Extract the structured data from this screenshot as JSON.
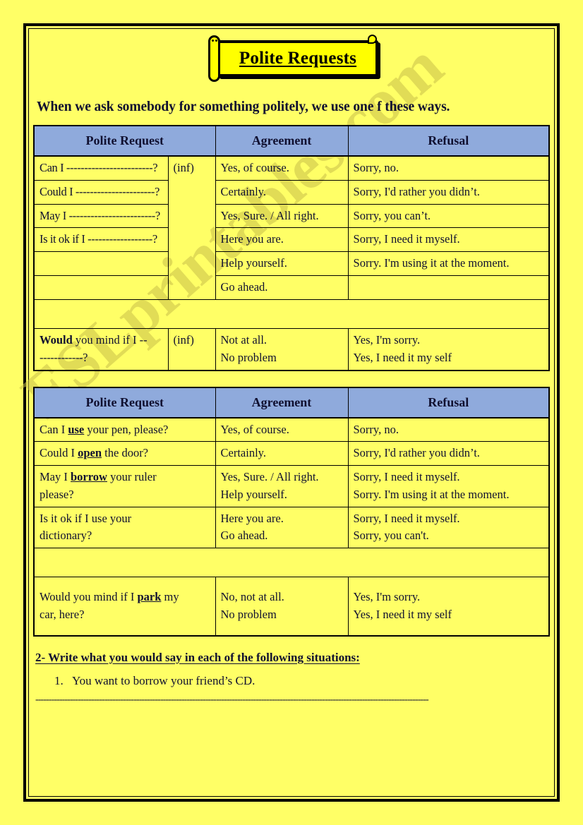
{
  "title": "Polite Requests",
  "intro": "When we ask somebody for something politely, we use one f these ways.",
  "table_headers": {
    "request": "Polite Request",
    "agreement": "Agreement",
    "refusal": "Refusal"
  },
  "inf_label": "(inf)",
  "table1": {
    "requests": [
      "Can I ------------------------?",
      "Could I ----------------------?",
      "May I ------------------------?",
      "Is it ok if I ------------------?",
      "",
      ""
    ],
    "agreements": [
      "Yes, of course.",
      "Certainly.",
      "Yes, Sure. / All right.",
      "Here you are.",
      "Help yourself.",
      "Go ahead."
    ],
    "refusals": [
      "Sorry, no.",
      "Sorry, I'd rather you didn’t.",
      "Sorry, you can’t.",
      "Sorry, I need it myself.",
      "Sorry. I'm using it at the moment.",
      ""
    ],
    "wouldmind_row": {
      "request_bold": "Would",
      "request_rest": " you mind if I --",
      "request_line2": "------------?",
      "agreement_line1": "Not at all.",
      "agreement_line2": "No problem",
      "refusal_line1": "Yes, I'm sorry.",
      "refusal_line2": "Yes, I need it my self"
    }
  },
  "table2": {
    "rows": [
      {
        "req_pre": "Can I ",
        "req_bold": "use",
        "req_post": " your pen, please?",
        "req_line2": "",
        "agreement1": "Yes, of course.",
        "agreement2": "",
        "refusal1": "Sorry, no.",
        "refusal2": ""
      },
      {
        "req_pre": "Could I ",
        "req_bold": "open",
        "req_post": " the door?",
        "req_line2": "",
        "agreement1": "Certainly.",
        "agreement2": "",
        "refusal1": "Sorry, I'd rather you didn’t.",
        "refusal2": ""
      },
      {
        "req_pre": "May I ",
        "req_bold": "borrow",
        "req_post": " your ruler",
        "req_line2": "please?",
        "agreement1": "Yes, Sure. / All right.",
        "agreement2": "Help yourself.",
        "refusal1": "Sorry, I need it myself.",
        "refusal2": "Sorry. I'm using it at the moment."
      },
      {
        "req_pre": "Is it ok if I use your",
        "req_bold": "",
        "req_post": "",
        "req_line2": "dictionary?",
        "agreement1": "Here you are.",
        "agreement2": "Go ahead.",
        "refusal1": "Sorry, I need it myself.",
        "refusal2": "Sorry, you can't."
      }
    ],
    "wouldmind_row": {
      "req_pre": "Would you mind if I ",
      "req_bold": "park",
      "req_post": " my",
      "req_line2": "car, here?",
      "agreement1": "No, not at all.",
      "agreement2": "No problem",
      "refusal1": "Yes, I'm sorry.",
      "refusal2": "Yes, I need it my self"
    }
  },
  "exercise": {
    "heading": "2- Write what you would say in each of the following situations:",
    "items": [
      "You want to borrow your friend’s CD."
    ],
    "answer_line": "----------------------------------------------------------------------------------------------------------------------------------------------------"
  },
  "watermark": "ESLprintables.com",
  "colors": {
    "page_background": "#FFFF66",
    "header_blue": "#8FAADC",
    "text_navy": "#101030",
    "banner_yellow": "#FFFF00",
    "watermark": "#C9C14A"
  }
}
